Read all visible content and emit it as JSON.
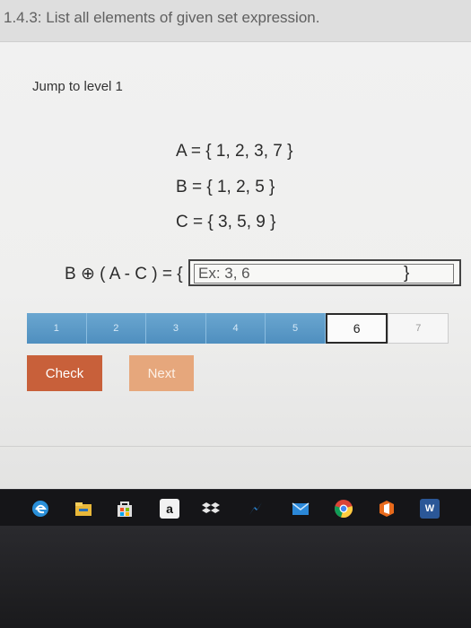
{
  "header": {
    "title": "1.4.3: List all elements of given set expression."
  },
  "jump_label": "Jump to level 1",
  "sets": [
    {
      "text": "A = { 1, 2, 3, 7 }"
    },
    {
      "text": "B = { 1, 2, 5 }"
    },
    {
      "text": "C = { 3, 5, 9 }"
    }
  ],
  "expression": {
    "label": "B ⊕ ( A - C ) = {",
    "placeholder": "Ex: 3, 6",
    "value": "",
    "close": "}"
  },
  "levels": [
    "1",
    "2",
    "3",
    "4",
    "5",
    "6",
    "7"
  ],
  "current_level": "6",
  "buttons": {
    "check": "Check",
    "next": "Next"
  },
  "taskbar": {
    "icons": [
      "edge-icon",
      "file-explorer-icon",
      "store-icon",
      "amazon-icon",
      "dropbox-icon",
      "messenger-icon",
      "mail-icon",
      "chrome-icon",
      "office-icon",
      "word-icon"
    ],
    "amazon_letter": "a",
    "word_letter": "W"
  },
  "colors": {
    "check_button": "#c8603a",
    "next_button": "#e6a77c",
    "level_bar": "#5b9ac8"
  }
}
